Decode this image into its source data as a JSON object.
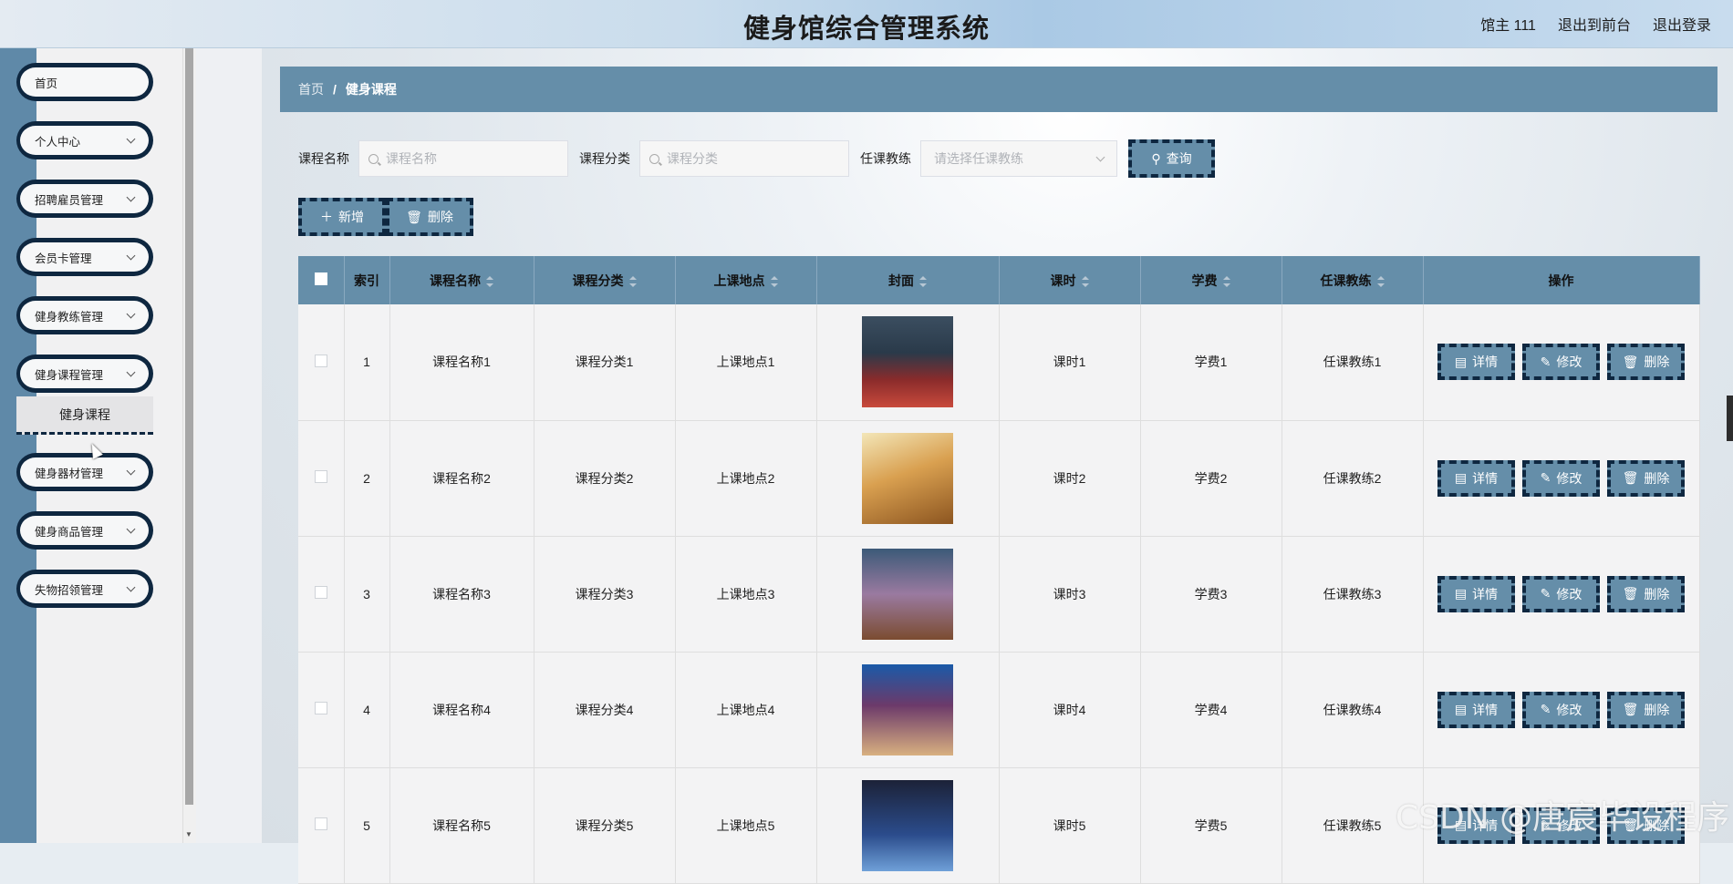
{
  "header": {
    "title": "健身馆综合管理系统",
    "user_label": "馆主 111",
    "back_front": "退出到前台",
    "logout": "退出登录"
  },
  "sidebar": {
    "items": [
      {
        "label": "首页",
        "has_children": false
      },
      {
        "label": "个人中心",
        "has_children": true
      },
      {
        "label": "招聘雇员管理",
        "has_children": true
      },
      {
        "label": "会员卡管理",
        "has_children": true
      },
      {
        "label": "健身教练管理",
        "has_children": true
      },
      {
        "label": "健身课程管理",
        "has_children": true,
        "expanded": true,
        "children": [
          "健身课程"
        ]
      },
      {
        "label": "健身器材管理",
        "has_children": true
      },
      {
        "label": "健身商品管理",
        "has_children": true
      },
      {
        "label": "失物招领管理",
        "has_children": true
      }
    ]
  },
  "breadcrumb": {
    "home": "首页",
    "separator": "/",
    "current": "健身课程"
  },
  "filters": {
    "name_label": "课程名称",
    "name_placeholder": "课程名称",
    "category_label": "课程分类",
    "category_placeholder": "课程分类",
    "coach_label": "任课教练",
    "coach_placeholder": "请选择任课教练",
    "query_button": "查询"
  },
  "actions": {
    "add": "新增",
    "delete": "删除"
  },
  "table": {
    "columns": [
      "",
      "索引",
      "课程名称",
      "课程分类",
      "上课地点",
      "封面",
      "课时",
      "学费",
      "任课教练",
      "操作"
    ],
    "rows": [
      {
        "index": "1",
        "name": "课程名称1",
        "category": "课程分类1",
        "location": "上课地点1",
        "hours": "课时1",
        "fee": "学费1",
        "coach": "任课教练1"
      },
      {
        "index": "2",
        "name": "课程名称2",
        "category": "课程分类2",
        "location": "上课地点2",
        "hours": "课时2",
        "fee": "学费2",
        "coach": "任课教练2"
      },
      {
        "index": "3",
        "name": "课程名称3",
        "category": "课程分类3",
        "location": "上课地点3",
        "hours": "课时3",
        "fee": "学费3",
        "coach": "任课教练3"
      },
      {
        "index": "4",
        "name": "课程名称4",
        "category": "课程分类4",
        "location": "上课地点4",
        "hours": "课时4",
        "fee": "学费4",
        "coach": "任课教练4"
      },
      {
        "index": "5",
        "name": "课程名称5",
        "category": "课程分类5",
        "location": "上课地点5",
        "hours": "课时5",
        "fee": "学费5",
        "coach": "任课教练5"
      }
    ],
    "row_actions": {
      "detail": "详情",
      "edit": "修改",
      "delete": "删除"
    }
  },
  "watermark": "CSDN @唐宸毕设程序",
  "colors": {
    "accent": "#658ea9",
    "border_dark": "#0e2740",
    "sidebar_strip": "#5f89a8"
  }
}
